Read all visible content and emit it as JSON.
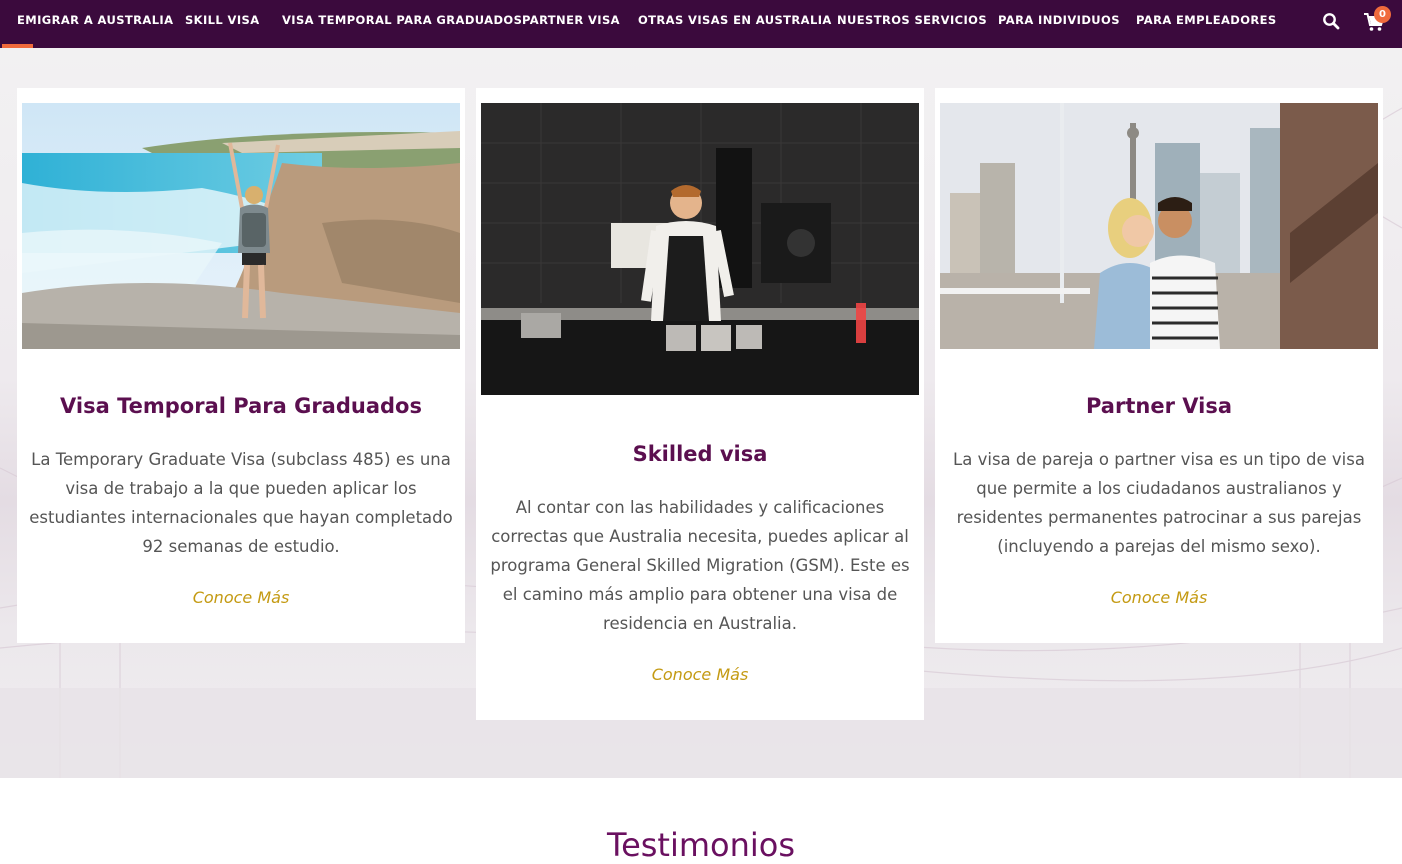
{
  "nav": {
    "items": [
      "EMIGRAR A AUSTRALIA",
      "SKILL VISA",
      "VISA TEMPORAL PARA GRADUADOS",
      "PARTNER VISA",
      "OTRAS VISAS EN AUSTRALIA",
      "NUESTROS SERVICIOS",
      "PARA INDIVIDUOS",
      "PARA EMPLEADORES"
    ],
    "cart_count": "0",
    "icons": [
      "search-icon",
      "cart-icon"
    ]
  },
  "colors": {
    "nav_bg": "#3b0a3d",
    "accent": "#f06a3c",
    "title": "#5b0f4f",
    "link": "#c49a12"
  },
  "cards": [
    {
      "title": "Visa Temporal Para Graduados",
      "text": "La Temporary Graduate Visa (subclass 485) es una visa de trabajo a la que pueden aplicar los estudiantes internacionales que hayan completado 92 semanas de estudio.",
      "link": "Conoce Más",
      "image": "woman-at-beach-photo"
    },
    {
      "title": "Skilled visa",
      "text": "Al contar con las habilidades y calificaciones correctas que Australia necesita, puedes aplicar al programa General Skilled Migration (GSM). Este es el camino más amplio para obtener una visa de residencia en Australia.",
      "link": "Conoce Más",
      "image": "chef-in-kitchen-photo"
    },
    {
      "title": "Partner Visa",
      "text": "La visa de pareja o partner visa es un tipo de visa que permite a los ciudadanos australianos y residentes permanentes patrocinar a sus parejas (incluyendo a parejas del mismo sexo).",
      "link": "Conoce Más",
      "image": "couple-in-city-photo"
    }
  ],
  "testimonials": {
    "title": "Testimonios"
  }
}
